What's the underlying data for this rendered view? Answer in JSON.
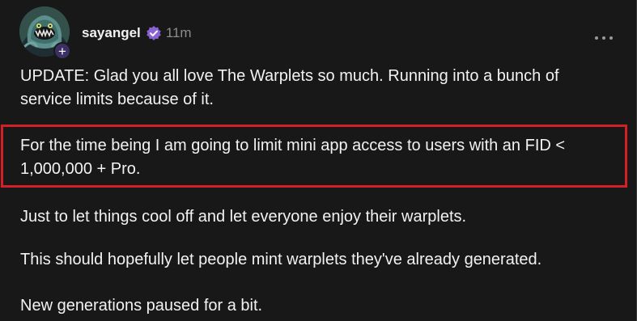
{
  "post": {
    "author": {
      "username": "sayangel",
      "verified_icon": "verified-badge-icon",
      "avatar_icon": "monster-avatar-icon",
      "follow_icon": "plus-icon"
    },
    "timestamp": "11m",
    "more_icon": "ellipsis-icon",
    "paragraphs": [
      "UPDATE: Glad you all love The Warplets so much. Running into a bunch of service limits because of it.",
      "For the time being I am going to limit mini app access to users with an FID < 1,000,000 + Pro.",
      "Just to let things cool off and let everyone enjoy their warplets.",
      "This should hopefully let people mint warplets they've already generated.",
      "New generations paused for a bit."
    ]
  },
  "annotation": {
    "highlight_color": "#d31f26"
  },
  "colors": {
    "background": "#181818",
    "text": "#f2f2f2",
    "muted": "#8c8c8c",
    "verified": "#8a63d2",
    "follow_badge": "#3b2f63"
  }
}
